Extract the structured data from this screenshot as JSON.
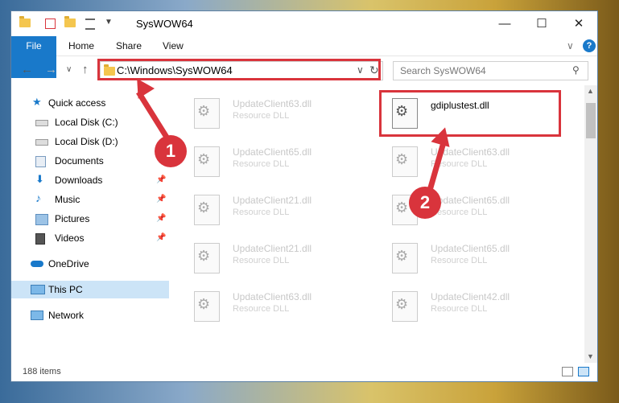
{
  "window": {
    "title": "SysWOW64",
    "minimize": "—",
    "maximize": "☐",
    "close": "✕"
  },
  "ribbon": {
    "tabs": [
      "File",
      "Home",
      "Share",
      "View"
    ],
    "chevron": "∨",
    "help": "?"
  },
  "address": {
    "path": "C:\\Windows\\SysWOW64",
    "dropdown": "∨",
    "refresh": "↻",
    "search_placeholder": "Search SysWOW64"
  },
  "nav": {
    "quick_access": "Quick access",
    "items": [
      "Local Disk (C:)",
      "Local Disk (D:)",
      "Documents",
      "Downloads",
      "Music",
      "Pictures",
      "Videos"
    ],
    "onedrive": "OneDrive",
    "this_pc": "This PC",
    "network": "Network"
  },
  "files": {
    "left": [
      {
        "name": "UpdateClient63.dll",
        "type": "Resource DLL"
      },
      {
        "name": "UpdateClient65.dll",
        "type": "Resource DLL"
      },
      {
        "name": "UpdateClient21.dll",
        "type": "Resource DLL"
      },
      {
        "name": "UpdateClient21.dll",
        "type": "Resource DLL"
      },
      {
        "name": "UpdateClient63.dll",
        "type": "Resource DLL"
      }
    ],
    "right": [
      {
        "name": "gdiplustest.dll",
        "type": ""
      },
      {
        "name": "UpdateClient63.dll",
        "type": "Resource DLL"
      },
      {
        "name": "UpdateClient65.dll",
        "type": "Resource DLL"
      },
      {
        "name": "UpdateClient65.dll",
        "type": "Resource DLL"
      },
      {
        "name": "UpdateClient42.dll",
        "type": "Resource DLL"
      }
    ]
  },
  "status": {
    "count": "188 items"
  },
  "annotations": {
    "badge1": "1",
    "badge2": "2"
  },
  "colors": {
    "accent": "#1979ca",
    "highlight": "#d9343c"
  }
}
